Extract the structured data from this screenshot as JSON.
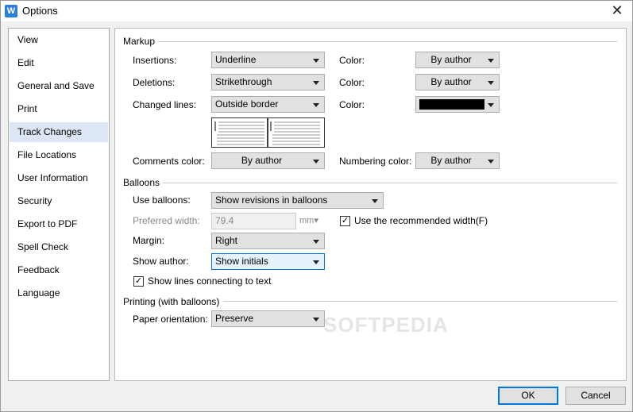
{
  "window": {
    "title": "Options",
    "app_icon": "W"
  },
  "sidebar": {
    "items": [
      {
        "label": "View"
      },
      {
        "label": "Edit"
      },
      {
        "label": "General and Save"
      },
      {
        "label": "Print"
      },
      {
        "label": "Track Changes"
      },
      {
        "label": "File Locations"
      },
      {
        "label": "User Information"
      },
      {
        "label": "Security"
      },
      {
        "label": "Export to PDF"
      },
      {
        "label": "Spell Check"
      },
      {
        "label": "Feedback"
      },
      {
        "label": "Language"
      }
    ],
    "active": "Track Changes"
  },
  "markup": {
    "title": "Markup",
    "insertions_label": "Insertions:",
    "insertions_value": "Underline",
    "deletions_label": "Deletions:",
    "deletions_value": "Strikethrough",
    "changed_lines_label": "Changed lines:",
    "changed_lines_value": "Outside border",
    "color_label": "Color:",
    "insertions_color": "By author",
    "deletions_color": "By author",
    "changed_lines_color": "#000000",
    "comments_color_label": "Comments color:",
    "comments_color_value": "By author",
    "numbering_color_label": "Numbering color:",
    "numbering_color_value": "By author"
  },
  "balloons": {
    "title": "Balloons",
    "use_balloons_label": "Use balloons:",
    "use_balloons_value": "Show revisions in balloons",
    "preferred_width_label": "Preferred width:",
    "preferred_width_value": "79.4",
    "preferred_width_unit": "mm",
    "recommended_width_label": "Use the recommended width(F)",
    "recommended_width_checked": true,
    "margin_label": "Margin:",
    "margin_value": "Right",
    "show_author_label": "Show author:",
    "show_author_value": "Show initials",
    "show_lines_label": "Show lines connecting to text",
    "show_lines_checked": true
  },
  "printing": {
    "title": "Printing (with balloons)",
    "paper_orientation_label": "Paper orientation:",
    "paper_orientation_value": "Preserve"
  },
  "buttons": {
    "ok": "OK",
    "cancel": "Cancel"
  },
  "watermark": "SOFTPEDIA",
  "colors": {
    "accent": "#0078d7",
    "sidebar_active": "#dce6f4"
  }
}
